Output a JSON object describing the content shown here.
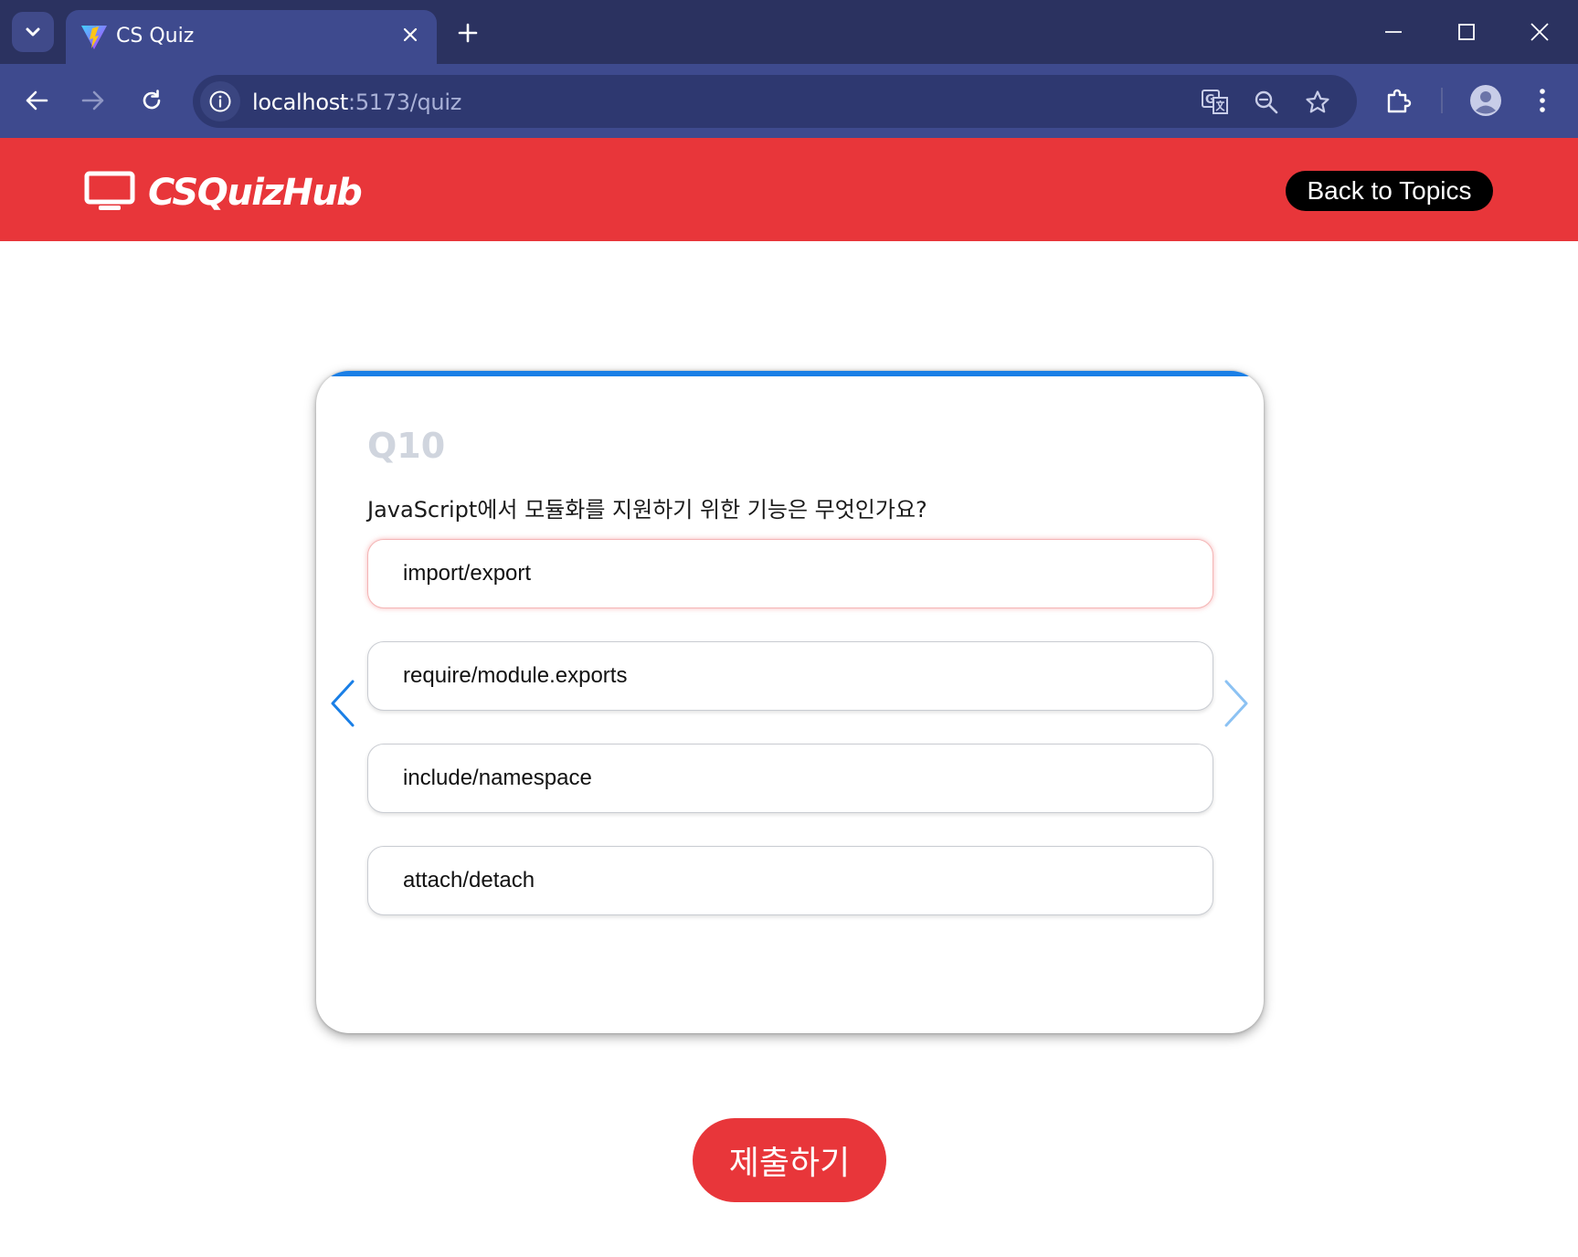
{
  "browser": {
    "tab_title": "CS Quiz",
    "url_host": "localhost",
    "url_path": ":5173/quiz"
  },
  "header": {
    "logo_text": "CSQuizHub",
    "back_button_label": "Back to Topics"
  },
  "quiz": {
    "question_number": "Q10",
    "question_text": "JavaScript에서 모듈화를 지원하기 위한 기능은 무엇인가요?",
    "options": [
      {
        "label": "import/export",
        "selected": true
      },
      {
        "label": "require/module.exports",
        "selected": false
      },
      {
        "label": "include/namespace",
        "selected": false
      },
      {
        "label": "attach/detach",
        "selected": false
      }
    ],
    "submit_label": "제출하기"
  },
  "colors": {
    "brand_red": "#e8363a",
    "accent_blue": "#1a7fe6",
    "chrome_bg": "#2b3260",
    "toolbar_bg": "#3e4a8e"
  }
}
